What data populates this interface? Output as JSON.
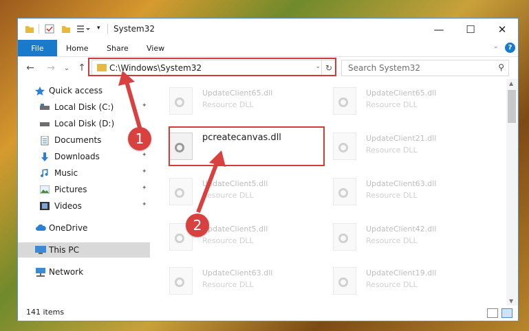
{
  "window": {
    "title": "System32",
    "controls": {
      "minimize": "—",
      "maximize": "☐",
      "close": "✕"
    }
  },
  "ribbon": {
    "file_tab": "File",
    "tabs": [
      "Home",
      "Share",
      "View"
    ],
    "help": "?",
    "collapse": "⌄"
  },
  "nav": {
    "back": "←",
    "forward": "→",
    "recent": "⌄",
    "up": "↑",
    "address": "C:\\Windows\\System32",
    "address_dropdown": "⌄",
    "refresh": "↻",
    "search_placeholder": "Search System32",
    "search_icon": "⚲"
  },
  "sidebar": {
    "items": [
      {
        "label": "Quick access",
        "icon": "star-icon"
      },
      {
        "label": "Local Disk (C:)",
        "icon": "drive-icon",
        "pinned": true
      },
      {
        "label": "Local Disk (D:)",
        "icon": "drive-icon",
        "pinned": false
      },
      {
        "label": "Documents",
        "icon": "documents-icon",
        "pinned": true
      },
      {
        "label": "Downloads",
        "icon": "download-icon",
        "pinned": true
      },
      {
        "label": "Music",
        "icon": "music-icon",
        "pinned": true
      },
      {
        "label": "Pictures",
        "icon": "pictures-icon",
        "pinned": true
      },
      {
        "label": "Videos",
        "icon": "videos-icon",
        "pinned": true
      },
      {
        "label": "OneDrive",
        "icon": "cloud-icon"
      },
      {
        "label": "This PC",
        "icon": "computer-icon",
        "selected": true
      },
      {
        "label": "Network",
        "icon": "network-icon"
      }
    ],
    "pin_glyph": "📌"
  },
  "files": {
    "highlighted": {
      "name": "pcreatecanvas.dll"
    },
    "left_column": [
      {
        "name": "UpdateClient65.dll",
        "type": "Resource DLL"
      },
      {
        "name": "UpdateClient5.dll",
        "type": "Resource DLL"
      },
      {
        "name": "UpdateClient5.dll",
        "type": "Resource DLL"
      },
      {
        "name": "UpdateClient63.dll",
        "type": "Resource DLL"
      }
    ],
    "right_column": [
      {
        "name": "UpdateClient65.dll",
        "type": "Resource DLL"
      },
      {
        "name": "UpdateClient21.dll",
        "type": "Resource DLL"
      },
      {
        "name": "UpdateClient63.dll",
        "type": "Resource DLL"
      },
      {
        "name": "UpdateClient42.dll",
        "type": "Resource DLL"
      },
      {
        "name": "UpdateClient19.dll",
        "type": "Resource DLL"
      }
    ]
  },
  "status": {
    "item_count": "141 items"
  },
  "annotations": {
    "step1": "1",
    "step2": "2",
    "accent": "#d94141"
  },
  "colors": {
    "accent_blue": "#1979ca",
    "highlight_red": "#d43838"
  }
}
